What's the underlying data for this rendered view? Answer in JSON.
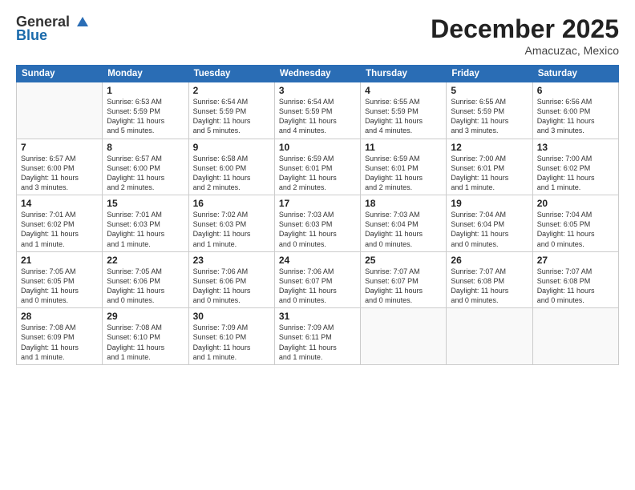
{
  "header": {
    "logo_general": "General",
    "logo_blue": "Blue",
    "month_year": "December 2025",
    "location": "Amacuzac, Mexico"
  },
  "weekdays": [
    "Sunday",
    "Monday",
    "Tuesday",
    "Wednesday",
    "Thursday",
    "Friday",
    "Saturday"
  ],
  "weeks": [
    [
      {
        "day": "",
        "info": ""
      },
      {
        "day": "1",
        "info": "Sunrise: 6:53 AM\nSunset: 5:59 PM\nDaylight: 11 hours\nand 5 minutes."
      },
      {
        "day": "2",
        "info": "Sunrise: 6:54 AM\nSunset: 5:59 PM\nDaylight: 11 hours\nand 5 minutes."
      },
      {
        "day": "3",
        "info": "Sunrise: 6:54 AM\nSunset: 5:59 PM\nDaylight: 11 hours\nand 4 minutes."
      },
      {
        "day": "4",
        "info": "Sunrise: 6:55 AM\nSunset: 5:59 PM\nDaylight: 11 hours\nand 4 minutes."
      },
      {
        "day": "5",
        "info": "Sunrise: 6:55 AM\nSunset: 5:59 PM\nDaylight: 11 hours\nand 3 minutes."
      },
      {
        "day": "6",
        "info": "Sunrise: 6:56 AM\nSunset: 6:00 PM\nDaylight: 11 hours\nand 3 minutes."
      }
    ],
    [
      {
        "day": "7",
        "info": "Sunrise: 6:57 AM\nSunset: 6:00 PM\nDaylight: 11 hours\nand 3 minutes."
      },
      {
        "day": "8",
        "info": "Sunrise: 6:57 AM\nSunset: 6:00 PM\nDaylight: 11 hours\nand 2 minutes."
      },
      {
        "day": "9",
        "info": "Sunrise: 6:58 AM\nSunset: 6:00 PM\nDaylight: 11 hours\nand 2 minutes."
      },
      {
        "day": "10",
        "info": "Sunrise: 6:59 AM\nSunset: 6:01 PM\nDaylight: 11 hours\nand 2 minutes."
      },
      {
        "day": "11",
        "info": "Sunrise: 6:59 AM\nSunset: 6:01 PM\nDaylight: 11 hours\nand 2 minutes."
      },
      {
        "day": "12",
        "info": "Sunrise: 7:00 AM\nSunset: 6:01 PM\nDaylight: 11 hours\nand 1 minute."
      },
      {
        "day": "13",
        "info": "Sunrise: 7:00 AM\nSunset: 6:02 PM\nDaylight: 11 hours\nand 1 minute."
      }
    ],
    [
      {
        "day": "14",
        "info": "Sunrise: 7:01 AM\nSunset: 6:02 PM\nDaylight: 11 hours\nand 1 minute."
      },
      {
        "day": "15",
        "info": "Sunrise: 7:01 AM\nSunset: 6:03 PM\nDaylight: 11 hours\nand 1 minute."
      },
      {
        "day": "16",
        "info": "Sunrise: 7:02 AM\nSunset: 6:03 PM\nDaylight: 11 hours\nand 1 minute."
      },
      {
        "day": "17",
        "info": "Sunrise: 7:03 AM\nSunset: 6:03 PM\nDaylight: 11 hours\nand 0 minutes."
      },
      {
        "day": "18",
        "info": "Sunrise: 7:03 AM\nSunset: 6:04 PM\nDaylight: 11 hours\nand 0 minutes."
      },
      {
        "day": "19",
        "info": "Sunrise: 7:04 AM\nSunset: 6:04 PM\nDaylight: 11 hours\nand 0 minutes."
      },
      {
        "day": "20",
        "info": "Sunrise: 7:04 AM\nSunset: 6:05 PM\nDaylight: 11 hours\nand 0 minutes."
      }
    ],
    [
      {
        "day": "21",
        "info": "Sunrise: 7:05 AM\nSunset: 6:05 PM\nDaylight: 11 hours\nand 0 minutes."
      },
      {
        "day": "22",
        "info": "Sunrise: 7:05 AM\nSunset: 6:06 PM\nDaylight: 11 hours\nand 0 minutes."
      },
      {
        "day": "23",
        "info": "Sunrise: 7:06 AM\nSunset: 6:06 PM\nDaylight: 11 hours\nand 0 minutes."
      },
      {
        "day": "24",
        "info": "Sunrise: 7:06 AM\nSunset: 6:07 PM\nDaylight: 11 hours\nand 0 minutes."
      },
      {
        "day": "25",
        "info": "Sunrise: 7:07 AM\nSunset: 6:07 PM\nDaylight: 11 hours\nand 0 minutes."
      },
      {
        "day": "26",
        "info": "Sunrise: 7:07 AM\nSunset: 6:08 PM\nDaylight: 11 hours\nand 0 minutes."
      },
      {
        "day": "27",
        "info": "Sunrise: 7:07 AM\nSunset: 6:08 PM\nDaylight: 11 hours\nand 0 minutes."
      }
    ],
    [
      {
        "day": "28",
        "info": "Sunrise: 7:08 AM\nSunset: 6:09 PM\nDaylight: 11 hours\nand 1 minute."
      },
      {
        "day": "29",
        "info": "Sunrise: 7:08 AM\nSunset: 6:10 PM\nDaylight: 11 hours\nand 1 minute."
      },
      {
        "day": "30",
        "info": "Sunrise: 7:09 AM\nSunset: 6:10 PM\nDaylight: 11 hours\nand 1 minute."
      },
      {
        "day": "31",
        "info": "Sunrise: 7:09 AM\nSunset: 6:11 PM\nDaylight: 11 hours\nand 1 minute."
      },
      {
        "day": "",
        "info": ""
      },
      {
        "day": "",
        "info": ""
      },
      {
        "day": "",
        "info": ""
      }
    ]
  ]
}
